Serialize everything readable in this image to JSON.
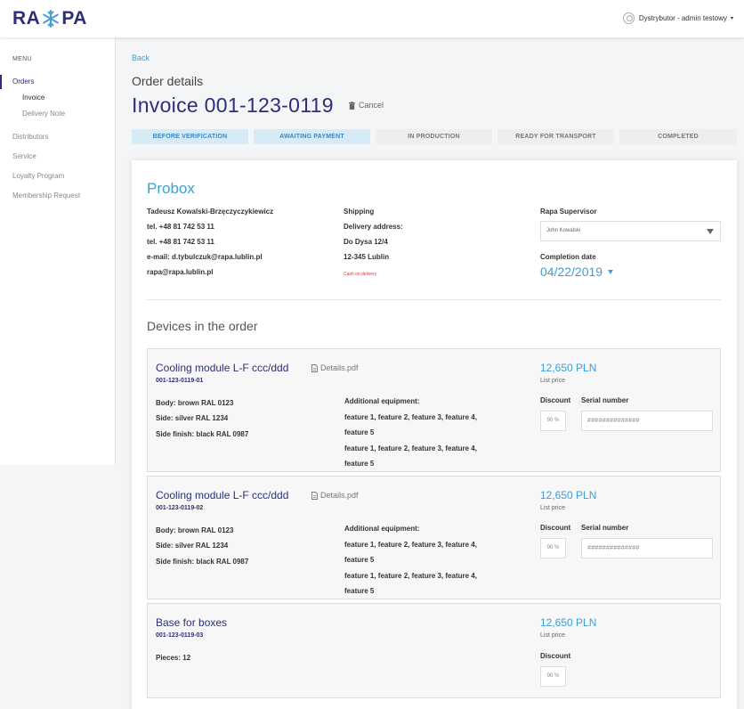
{
  "header": {
    "logo_left": "RA",
    "logo_right": "PA",
    "user_label": "Dystrybutor - admin testowy",
    "user_caret": "▾"
  },
  "sidebar": {
    "menu_title": "MENU",
    "items": [
      {
        "label": "Orders"
      },
      {
        "label": "Invoice"
      },
      {
        "label": "Delivery Note"
      },
      {
        "label": "Distributors"
      },
      {
        "label": "Service"
      },
      {
        "label": "Loyalty Program"
      },
      {
        "label": "Membership Request"
      }
    ]
  },
  "page": {
    "back": "Back",
    "section_title": "Order details",
    "invoice_title": "Invoice 001-123-0119",
    "cancel": "Cancel"
  },
  "steps": [
    {
      "label": "BEFORE VERIFICATION",
      "done": true
    },
    {
      "label": "AWAITING PAYMENT",
      "done": true
    },
    {
      "label": "IN PRODUCTION",
      "done": false
    },
    {
      "label": "READY FOR TRANSPORT",
      "done": false
    },
    {
      "label": "COMPLETED",
      "done": false
    }
  ],
  "customer": {
    "company": "Probox",
    "contact": [
      "Tadeusz Kowalski-Brzęczyczykiewicz",
      "tel. +48 81 742 53 11",
      "tel. +48 81 742 53 11",
      "e-mail: d.tybulczuk@rapa.lublin.pl",
      "rapa@rapa.lublin.pl"
    ],
    "shipping": [
      "Shipping",
      "Delivery address:",
      "Do Dysa 12/4",
      "12-345 Lublin"
    ],
    "payment_note": "Cash on delivery",
    "supervisor_label": "Rapa Supervisor",
    "supervisor_value": "John Kowalski",
    "completion_label": "Completion date",
    "completion_value": "04/22/2019"
  },
  "devices_title": "Devices in the order",
  "devices": [
    {
      "name": "Cooling module L-F ccc/ddd",
      "code": "001-123-0119-01",
      "pdf": "Details.pdf",
      "price": "12,650 PLN",
      "price_sub": "List price",
      "specs": [
        "Body: brown RAL 0123",
        "Side: silver RAL 1234",
        "Side finish: black RAL 0987"
      ],
      "equip_title": "Additional equipment:",
      "equip_lines": [
        "feature 1, feature 2, feature 3, feature 4,",
        "feature 5",
        "feature 1, feature 2, feature 3, feature 4,",
        "feature 5"
      ],
      "discount_label": "Discount",
      "discount_value": "90 %",
      "serial_label": "Serial number",
      "serial_value": "##############"
    },
    {
      "name": "Cooling module L-F ccc/ddd",
      "code": "001-123-0119-02",
      "pdf": "Details.pdf",
      "price": "12,650 PLN",
      "price_sub": "List price",
      "specs": [
        "Body: brown RAL 0123",
        "Side: silver RAL 1234",
        "Side finish: black RAL 0987"
      ],
      "equip_title": "Additional equipment:",
      "equip_lines": [
        "feature 1, feature 2, feature 3, feature 4,",
        "feature 5",
        "feature 1, feature 2, feature 3, feature 4,",
        "feature 5"
      ],
      "discount_label": "Discount",
      "discount_value": "90 %",
      "serial_label": "Serial number",
      "serial_value": "##############"
    },
    {
      "name": "Base for boxes",
      "code": "001-123-0119-03",
      "price": "12,650 PLN",
      "price_sub": "List price",
      "pieces": "Pieces: 12",
      "discount_label": "Discount",
      "discount_value": "90 %"
    }
  ],
  "colors": {
    "brand": "#2b2f7a",
    "accent": "#3aa0d6",
    "step_done_bg": "#d6ebf6",
    "step_todo_bg": "#eeeeee",
    "danger": "#d23a3a"
  }
}
